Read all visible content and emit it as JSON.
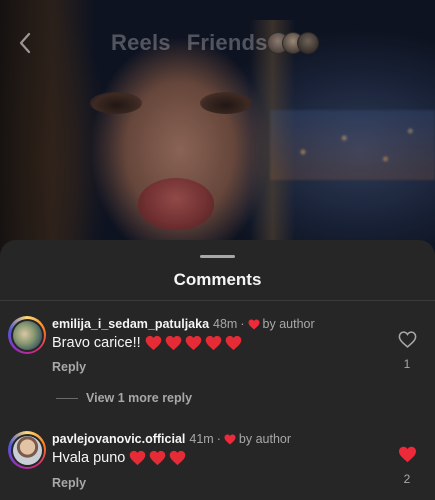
{
  "header": {
    "tabs": [
      {
        "label": "Reels"
      },
      {
        "label": "Friends"
      }
    ],
    "friend_avatar_count": 3
  },
  "sheet": {
    "title": "Comments"
  },
  "comments": [
    {
      "username": "emilija_i_sedam_patuljaka",
      "time": "48m",
      "separator": "·",
      "liked_by_author_label": "by author",
      "text": "Bravo carice!!",
      "emoji_hearts": 5,
      "reply_label": "Reply",
      "like_count": "1",
      "liked": false,
      "view_replies_label": "View 1 more reply"
    },
    {
      "username": "pavlejovanovic.official",
      "time": "41m",
      "separator": "·",
      "liked_by_author_label": "by author",
      "text": "Hvala puno",
      "emoji_hearts": 3,
      "reply_label": "Reply",
      "like_count": "2",
      "liked": true
    }
  ],
  "colors": {
    "sheet_bg": "#262626",
    "heart_red": "#ed2a3a",
    "text_primary": "#f5f5f5",
    "text_secondary": "#a8a8a8"
  }
}
